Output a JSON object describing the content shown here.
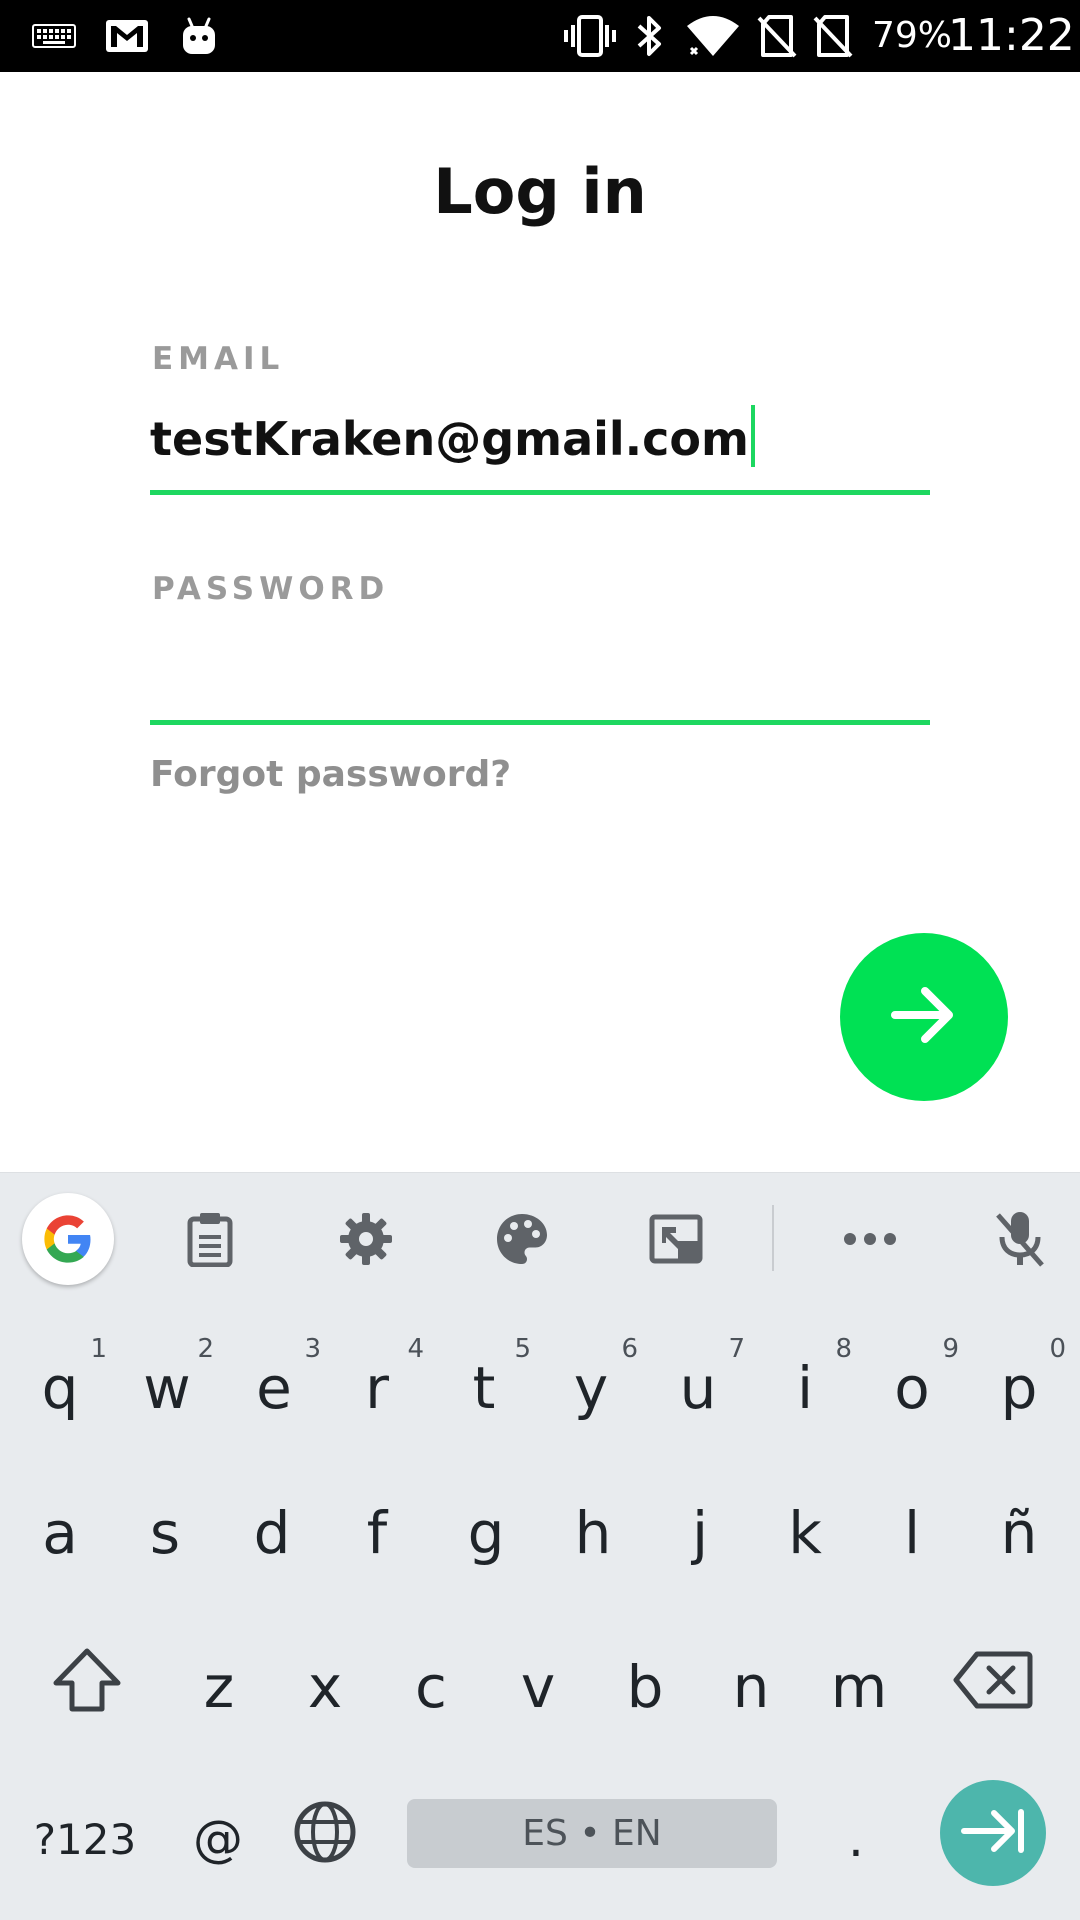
{
  "status_bar": {
    "icons": [
      "keyboard-icon",
      "gmail-icon",
      "android-icon",
      "vibrate-icon",
      "bluetooth-icon",
      "wifi-icon",
      "no-sim-icon",
      "no-sim-icon"
    ],
    "battery": "79%",
    "time": "11:22"
  },
  "login": {
    "title": "Log in",
    "email_label": "EMAIL",
    "email_value": "testKraken@gmail.com",
    "password_label": "PASSWORD",
    "password_value": "",
    "forgot_label": "Forgot password?",
    "submit_icon": "arrow-right-icon"
  },
  "keyboard": {
    "toolbar_icons": [
      "google-icon",
      "clipboard-icon",
      "gear-icon",
      "palette-icon",
      "one-handed-icon",
      "more-icon",
      "mic-off-icon"
    ],
    "row1": [
      {
        "key": "q",
        "hint": "1"
      },
      {
        "key": "w",
        "hint": "2"
      },
      {
        "key": "e",
        "hint": "3"
      },
      {
        "key": "r",
        "hint": "4"
      },
      {
        "key": "t",
        "hint": "5"
      },
      {
        "key": "y",
        "hint": "6"
      },
      {
        "key": "u",
        "hint": "7"
      },
      {
        "key": "i",
        "hint": "8"
      },
      {
        "key": "o",
        "hint": "9"
      },
      {
        "key": "p",
        "hint": "0"
      }
    ],
    "row2": [
      "a",
      "s",
      "d",
      "f",
      "g",
      "h",
      "j",
      "k",
      "l",
      "ñ"
    ],
    "row3": [
      "z",
      "x",
      "c",
      "v",
      "b",
      "n",
      "m"
    ],
    "symbols_label": "?123",
    "at_label": "@",
    "space_label": "ES • EN",
    "period_label": ".",
    "colors": {
      "accent": "#1ed760",
      "fab": "#00e154",
      "enter": "#4db6ac",
      "keyboard_bg": "#e8ebee"
    }
  }
}
